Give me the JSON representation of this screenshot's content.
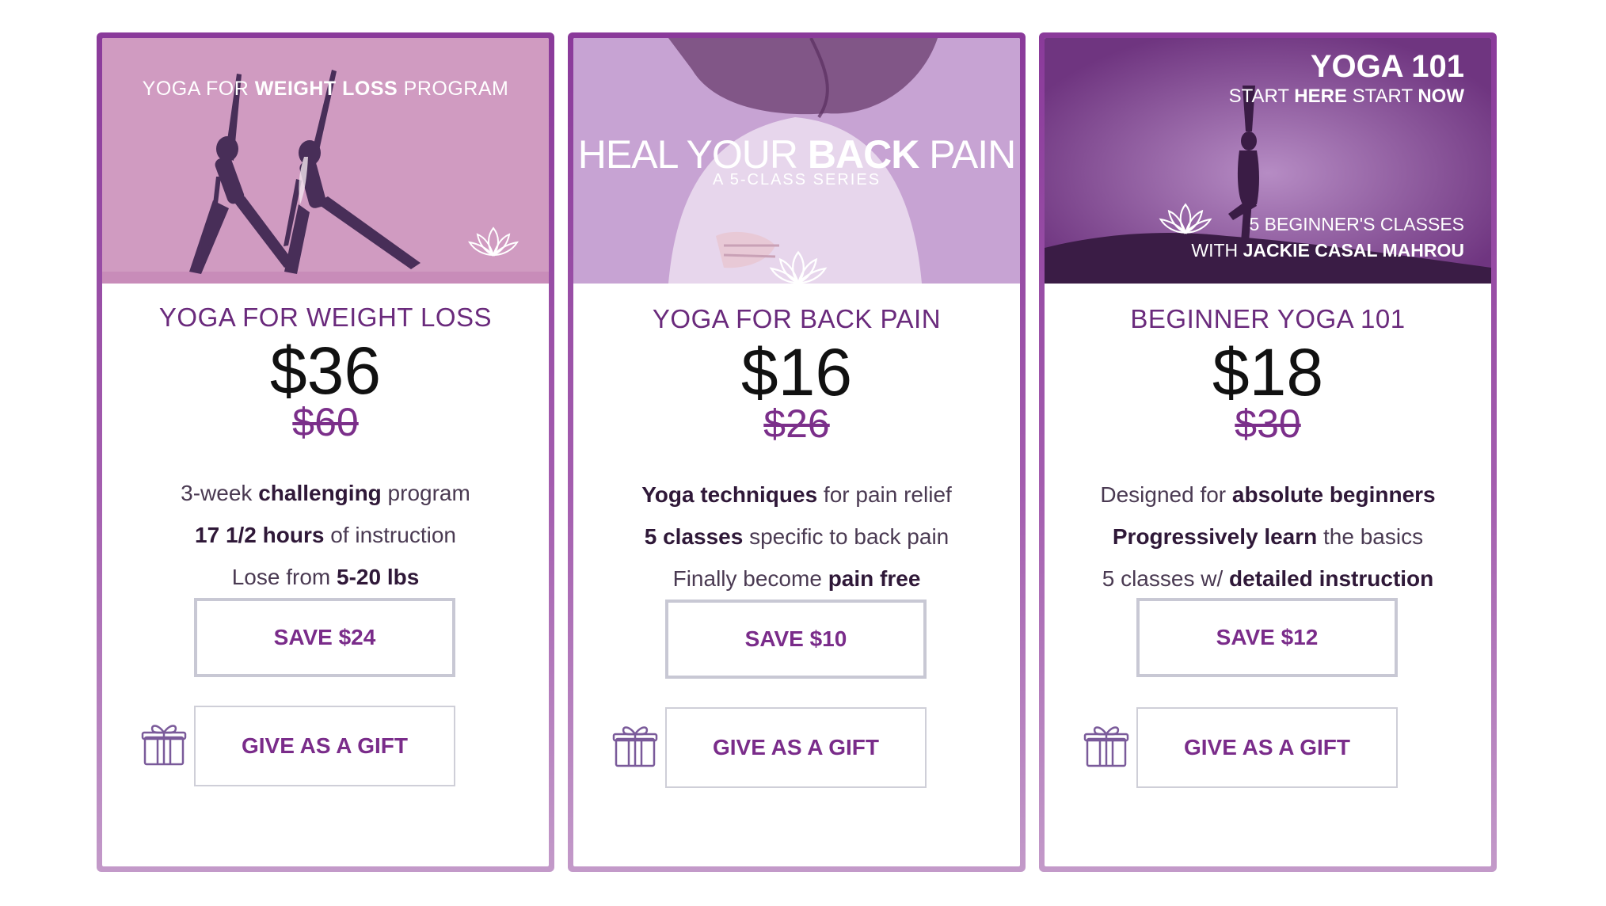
{
  "cards": [
    {
      "hero": {
        "line1_pre": "YOGA FOR ",
        "line1_bold": "WEIGHT LOSS",
        "line1_post": " PROGRAM"
      },
      "title": "YOGA FOR WEIGHT LOSS",
      "price": "$36",
      "old_price": "$60",
      "features": [
        {
          "pre": "3-week ",
          "hl": "challenging",
          "post": " program"
        },
        {
          "pre": "",
          "hl": "17 1/2 hours",
          "post": " of instruction"
        },
        {
          "pre": "Lose from ",
          "hl": "5-20 lbs",
          "post": ""
        }
      ],
      "save_label": "SAVE $24",
      "gift_label": "GIVE AS A GIFT"
    },
    {
      "hero": {
        "line1_pre": "HEAL YOUR ",
        "line1_bold": "BACK",
        "line1_post": " PAIN",
        "line2": "A 5-CLASS SERIES"
      },
      "title": "YOGA FOR BACK PAIN",
      "price": "$16",
      "old_price": "$26",
      "features": [
        {
          "pre": "",
          "hl": "Yoga techniques",
          "post": " for pain relief"
        },
        {
          "pre": "",
          "hl": "5 classes",
          "post": " specific to back pain"
        },
        {
          "pre": "Finally become ",
          "hl": "pain free",
          "post": ""
        }
      ],
      "save_label": "SAVE $10",
      "gift_label": "GIVE AS A GIFT"
    },
    {
      "hero": {
        "line1": "YOGA 101",
        "line2_pre": "START ",
        "line2_bold": "HERE",
        "line2_mid": " START ",
        "line2_bold2": "NOW",
        "line3": "5 BEGINNER'S CLASSES",
        "line4_pre": "WITH ",
        "line4_bold": "JACKIE CASAL MAHROU"
      },
      "title": "BEGINNER YOGA 101",
      "price": "$18",
      "old_price": "$30",
      "features": [
        {
          "pre": "Designed for ",
          "hl": "absolute beginners",
          "post": ""
        },
        {
          "pre": "",
          "hl": "Progressively learn",
          "post": " the basics"
        },
        {
          "pre": "5 classes w/ ",
          "hl": "detailed instruction",
          "post": ""
        }
      ],
      "save_label": "SAVE $12",
      "gift_label": "GIVE AS A GIFT"
    }
  ],
  "icons": {
    "lotus": "lotus-icon",
    "gift": "gift-icon"
  },
  "colors": {
    "accent": "#7a2c8a",
    "border": "#8a3a9a",
    "hero1": "#d19ac0",
    "hero2": "#c8a6d6",
    "hero3": "#7a3f86"
  }
}
